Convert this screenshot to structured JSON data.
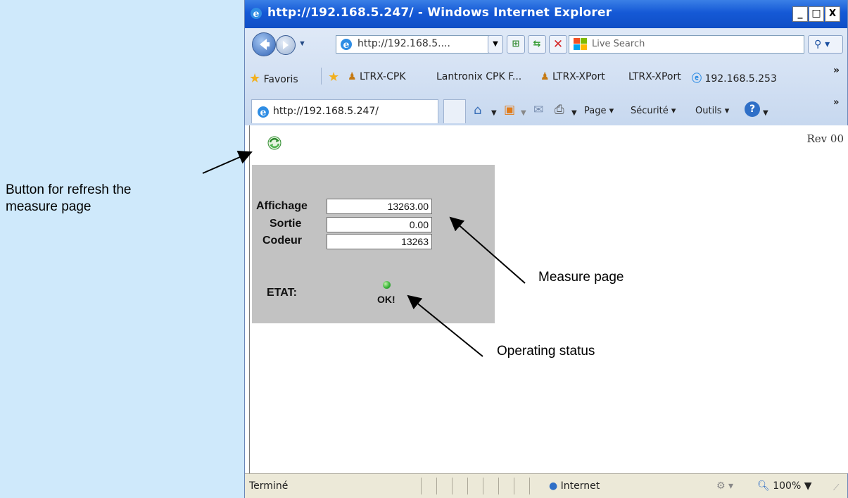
{
  "annotations": {
    "refresh_line1": "Button for refresh the",
    "refresh_line2": "measure page",
    "measure_page": "Measure page",
    "operating_status": "Operating status"
  },
  "window": {
    "title": "http://192.168.5.247/ - Windows Internet Explorer",
    "minimize": "_",
    "maximize": "□",
    "close": "X"
  },
  "address_bar": {
    "url": "http://192.168.5...."
  },
  "search": {
    "placeholder": "Live Search"
  },
  "favorites": {
    "label": "Favoris",
    "items": [
      "LTRX-CPK",
      "Lantronix CPK F...",
      "LTRX-XPort",
      "LTRX-XPort",
      "192.168.5.253"
    ],
    "overflow": "»"
  },
  "tab": {
    "label": "http://192.168.5.247/"
  },
  "commands": {
    "page": "Page",
    "security": "Sécurité",
    "tools": "Outils",
    "overflow": "»"
  },
  "page": {
    "rev": "Rev 00",
    "fields": [
      {
        "label": "Affichage",
        "value": "13263.00"
      },
      {
        "label": "Sortie",
        "value": "0.00"
      },
      {
        "label": "Codeur",
        "value": "13263"
      }
    ],
    "state_label": "ETAT:",
    "state_text": "OK!",
    "state_color": "#3bb53b"
  },
  "status_bar": {
    "text": "Terminé",
    "zone": "Internet",
    "zoom": "100%"
  },
  "colors": {
    "titlebar": "#1559d6",
    "background": "#cfe9fb",
    "panel": "#c2c2c2"
  }
}
